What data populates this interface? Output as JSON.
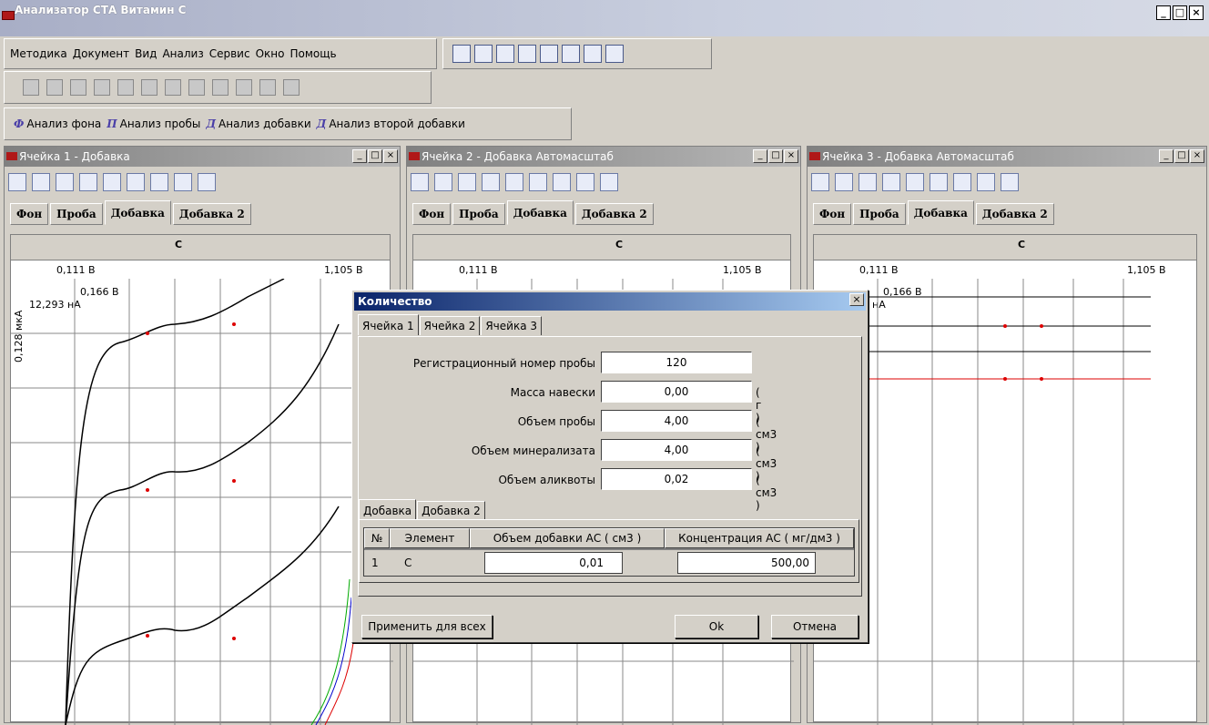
{
  "app": {
    "title": "Анализатор СТА Витамин С",
    "title_shadow": "Анализатор СТА Витамин С"
  },
  "menu": [
    "Методика",
    "Документ",
    "Вид",
    "Анализ",
    "Сервис",
    "Окно",
    "Помощь"
  ],
  "analysis_toolbar": [
    "Анализ фона",
    "Анализ пробы",
    "Анализ добавки",
    "Анализ второй добавки"
  ],
  "analysis_icons": [
    "Ф",
    "П",
    "Д",
    "Д"
  ],
  "cells": [
    {
      "title": "Ячейка 1 - Добавка",
      "tabs": [
        "Фон",
        "Проба",
        "Добавка",
        "Добавка 2"
      ],
      "active_tab": "Добавка",
      "element": "C",
      "x_left": "0,111 В",
      "x_right": "1,105 В",
      "marker": "0,166 В",
      "scale_label": "12,293 нА",
      "y_label": "0,128 мкА"
    },
    {
      "title": "Ячейка 2 - Добавка Автомасштаб",
      "tabs": [
        "Фон",
        "Проба",
        "Добавка",
        "Добавка 2"
      ],
      "active_tab": "Добавка",
      "element": "C",
      "x_left": "0,111 В",
      "x_right": "1,105 В"
    },
    {
      "title": "Ячейка 3 - Добавка Автомасштаб",
      "tabs": [
        "Фон",
        "Проба",
        "Добавка",
        "Добавка 2"
      ],
      "active_tab": "Добавка",
      "element": "C",
      "x_left": "0,111 В",
      "x_right": "1,105 В",
      "marker": "0,166 В",
      "scale_label": "нА"
    }
  ],
  "dialog": {
    "title": "Количество",
    "tabs": [
      "Ячейка 1",
      "Ячейка 2",
      "Ячейка 3"
    ],
    "fields": [
      {
        "label": "Регистрационный номер пробы",
        "value": "120",
        "unit": ""
      },
      {
        "label": "Масса навески",
        "value": "0,00",
        "unit": "( г )"
      },
      {
        "label": "Объем пробы",
        "value": "4,00",
        "unit": "( см3 )"
      },
      {
        "label": "Объем минерализата",
        "value": "4,00",
        "unit": "( см3 )"
      },
      {
        "label": "Объем аликвоты",
        "value": "0,02",
        "unit": "( см3 )"
      }
    ],
    "inner_tabs": [
      "Добавка",
      "Добавка 2"
    ],
    "table": {
      "headers": [
        "№",
        "Элемент",
        "Объем добавки АС ( см3 )",
        "Концентрация АС ( мг/дм3 )"
      ],
      "row": {
        "num": "1",
        "element": "C",
        "volume": "0,01",
        "conc": "500,00"
      }
    },
    "buttons": {
      "apply": "Применить для всех",
      "ok": "Ok",
      "cancel": "Отмена"
    }
  },
  "window_buttons": {
    "min": "_",
    "max": "□",
    "close": "×"
  }
}
